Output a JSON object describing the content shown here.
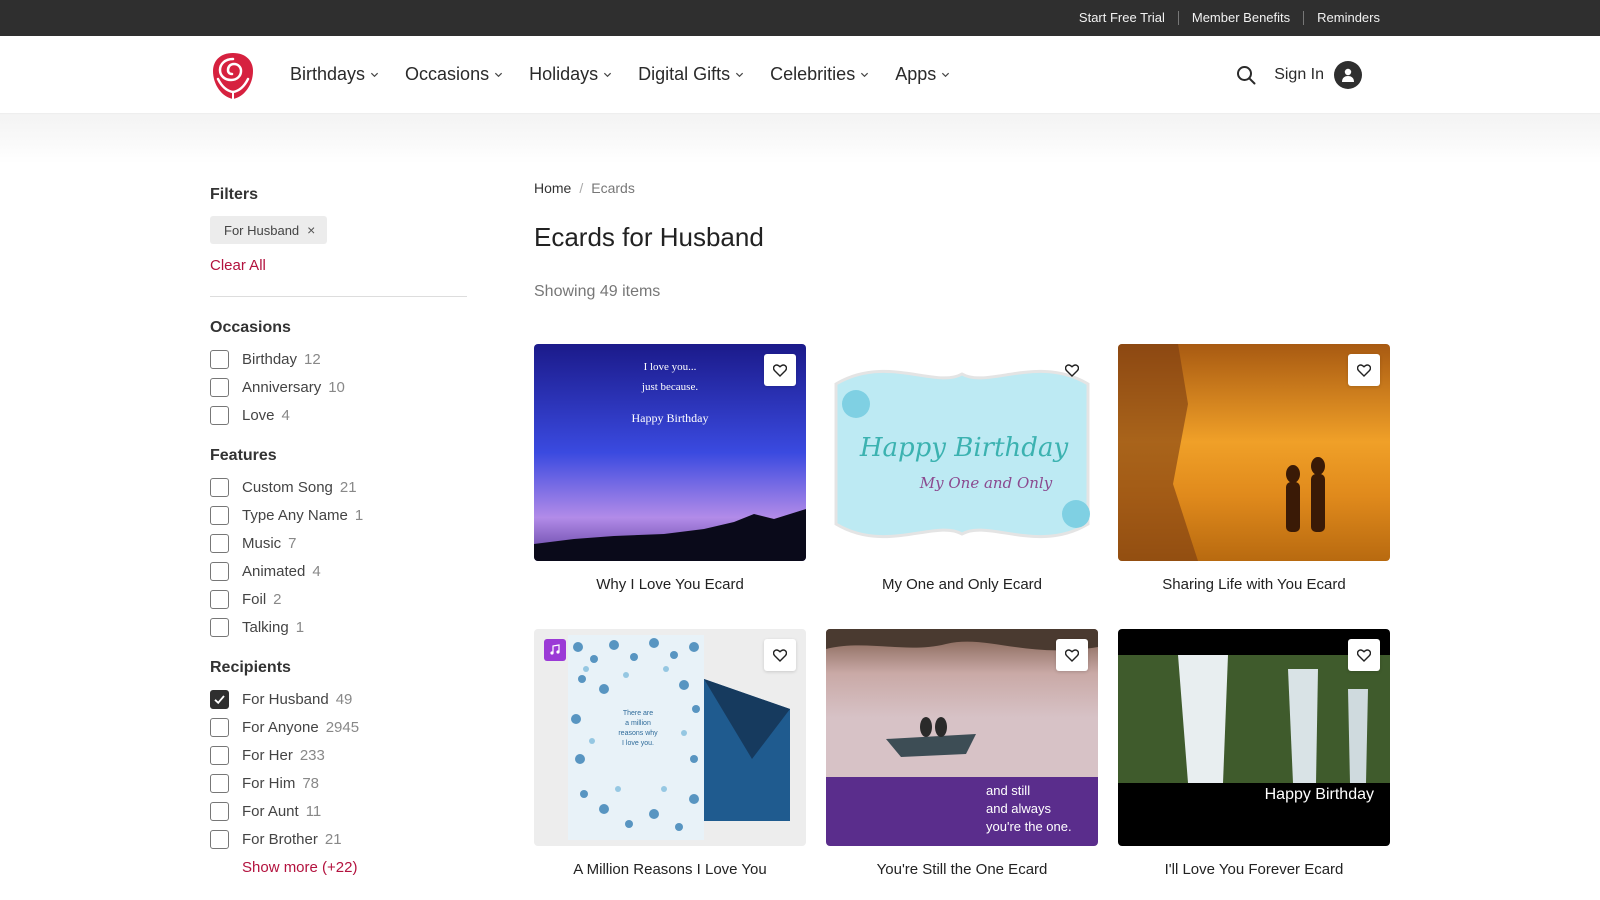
{
  "topbar": {
    "links": [
      "Start Free Trial",
      "Member Benefits",
      "Reminders"
    ]
  },
  "header": {
    "nav": [
      "Birthdays",
      "Occasions",
      "Holidays",
      "Digital Gifts",
      "Celebrities",
      "Apps"
    ],
    "sign_in": "Sign In"
  },
  "sidebar": {
    "filters_title": "Filters",
    "active_filter": "For Husband",
    "remove_symbol": "×",
    "clear_all": "Clear All",
    "occasions": {
      "title": "Occasions",
      "items": [
        {
          "label": "Birthday",
          "count": "12",
          "checked": false
        },
        {
          "label": "Anniversary",
          "count": "10",
          "checked": false
        },
        {
          "label": "Love",
          "count": "4",
          "checked": false
        }
      ]
    },
    "features": {
      "title": "Features",
      "items": [
        {
          "label": "Custom Song",
          "count": "21",
          "checked": false
        },
        {
          "label": "Type Any Name",
          "count": "1",
          "checked": false
        },
        {
          "label": "Music",
          "count": "7",
          "checked": false
        },
        {
          "label": "Animated",
          "count": "4",
          "checked": false
        },
        {
          "label": "Foil",
          "count": "2",
          "checked": false
        },
        {
          "label": "Talking",
          "count": "1",
          "checked": false
        }
      ]
    },
    "recipients": {
      "title": "Recipients",
      "items": [
        {
          "label": "For Husband",
          "count": "49",
          "checked": true
        },
        {
          "label": "For Anyone",
          "count": "2945",
          "checked": false
        },
        {
          "label": "For Her",
          "count": "233",
          "checked": false
        },
        {
          "label": "For Him",
          "count": "78",
          "checked": false
        },
        {
          "label": "For Aunt",
          "count": "11",
          "checked": false
        },
        {
          "label": "For Brother",
          "count": "21",
          "checked": false
        }
      ],
      "show_more": "Show more (+22)"
    }
  },
  "main": {
    "breadcrumb": {
      "home": "Home",
      "sep": "/",
      "current": "Ecards"
    },
    "title": "Ecards for Husband",
    "showing": "Showing 49 items",
    "cards": [
      {
        "title": "Why I Love You Ecard",
        "art": [
          "I love you...",
          "just because.",
          "Happy Birthday"
        ]
      },
      {
        "title": "My One and Only Ecard",
        "art": [
          "Happy Birthday",
          "My One and Only"
        ]
      },
      {
        "title": "Sharing Life with You Ecard",
        "art": []
      },
      {
        "title": "A Million Reasons I Love You",
        "art": [
          "There are",
          "a million",
          "reasons why",
          "I love you."
        ]
      },
      {
        "title": "You're Still the One Ecard",
        "art": [
          "and still",
          "and always",
          "you're the one."
        ]
      },
      {
        "title": "I'll Love You Forever Ecard",
        "art": [
          "Happy Birthday"
        ]
      }
    ]
  },
  "colors": {
    "brand_red": "#d6213f",
    "link_red": "#b3123e",
    "topbar_bg": "#2f2f2f",
    "badge_purple": "#9b3ad6"
  },
  "icons": {
    "logo": "rose-logo-icon",
    "search": "search-icon",
    "account": "user-icon",
    "favorite": "heart-icon",
    "chevron": "chevron-down-icon",
    "music_badge": "music-note-icon",
    "check": "check-icon"
  }
}
